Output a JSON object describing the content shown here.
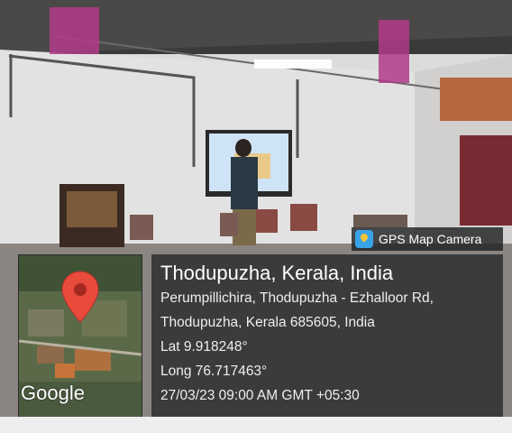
{
  "overlay": {
    "app_name": "GPS Map Camera",
    "location_title": "Thodupuzha, Kerala, India",
    "address_line_1": "Perumpillichira, Thodupuzha - Ezhalloor Rd,",
    "address_line_2": "Thodupuzha, Kerala 685605, India",
    "latitude": "Lat 9.918248°",
    "longitude": "Long 76.717463°",
    "datetime": "27/03/23 09:00 AM GMT +05:30",
    "map_brand": "Google",
    "app_icon": "gps-map-camera-icon",
    "marker_icon": "map-pin-icon",
    "pin_color": "#e84a3c"
  }
}
